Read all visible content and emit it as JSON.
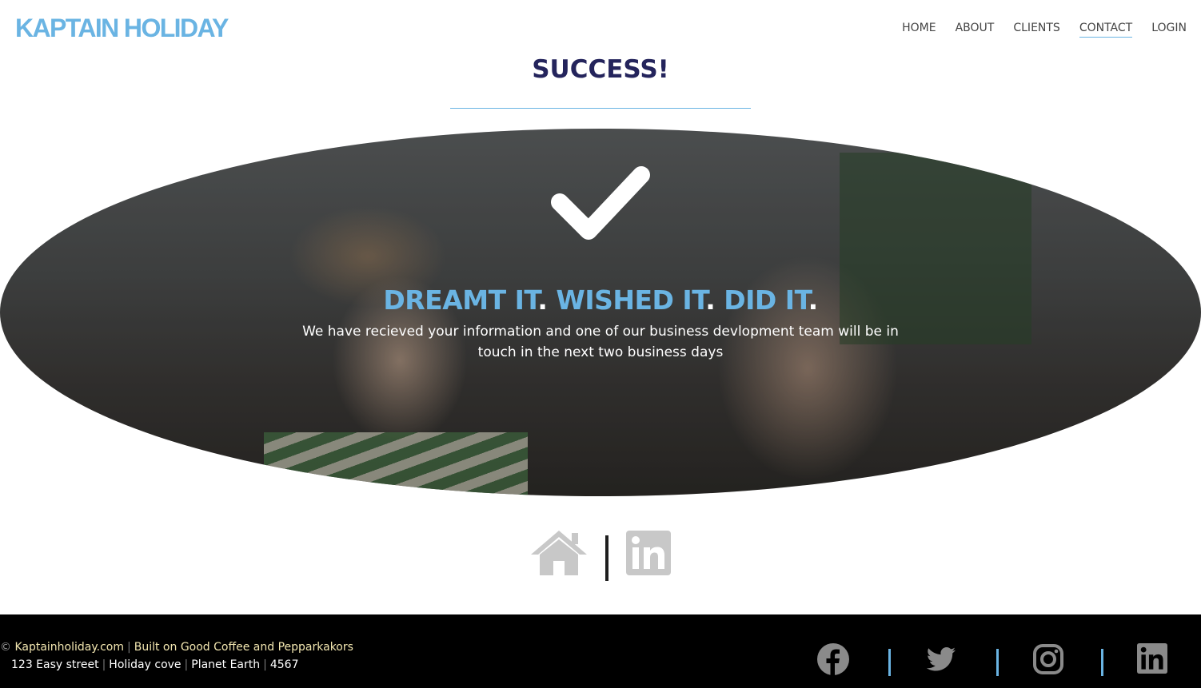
{
  "header": {
    "logo": "KAPTAIN HOLIDAY",
    "nav": [
      {
        "label": "HOME"
      },
      {
        "label": "ABOUT"
      },
      {
        "label": "CLIENTS"
      },
      {
        "label": "CONTACT",
        "active": true
      },
      {
        "label": "LOGIN"
      }
    ]
  },
  "main": {
    "title": "SUCCESS!",
    "hero": {
      "icon": "check-icon",
      "slogan": {
        "words": [
          "DREAMT IT",
          "WISHED IT",
          "DID IT"
        ],
        "separator": "."
      },
      "message": "We have recieved your information and one of our business devlopment team will be in touch in the next two business days"
    },
    "links": {
      "icons": [
        "home-icon",
        "linkedin-icon"
      ],
      "divider": "|"
    }
  },
  "footer": {
    "copyright_symbol": "©",
    "site": "Kaptainholiday.com",
    "tagline": "Built on Good Coffee and Pepparkakors",
    "address": [
      "123 Easy street",
      "Holiday cove",
      "Planet Earth",
      "4567"
    ],
    "separator": "|",
    "social_icons": [
      "facebook-icon",
      "twitter-icon",
      "instagram-icon",
      "linkedin-icon"
    ]
  },
  "colors": {
    "brand_blue": "#6ab4e3",
    "title_navy": "#24245c",
    "footer_bg": "#000000",
    "icon_gray": "#c8c8c8",
    "footer_icon_gray": "#8a8a8a"
  }
}
